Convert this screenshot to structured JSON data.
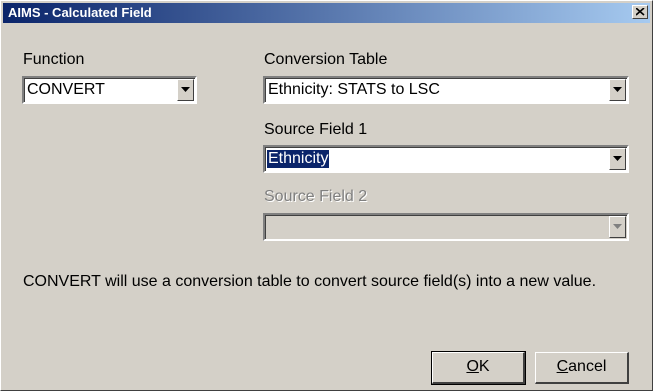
{
  "window": {
    "title": "AIMS - Calculated Field"
  },
  "function": {
    "label": "Function",
    "value": "CONVERT"
  },
  "conversion_table": {
    "label": "Conversion Table",
    "value": "Ethnicity:  STATS  to LSC"
  },
  "source_field_1": {
    "label": "Source Field 1",
    "value": "Ethnicity"
  },
  "source_field_2": {
    "label": "Source Field 2",
    "value": ""
  },
  "description": "CONVERT will use a conversion table to convert source field(s) into a new value.",
  "buttons": {
    "ok_accel": "O",
    "ok_rest": "K",
    "cancel_accel": "C",
    "cancel_rest": "ancel"
  },
  "icons": {
    "close": "close-icon",
    "dropdown": "chevron-down-icon"
  },
  "colors": {
    "titlebar_start": "#0a246a",
    "titlebar_end": "#a6caf0",
    "selection": "#0a246a",
    "face": "#d4d0c8"
  }
}
